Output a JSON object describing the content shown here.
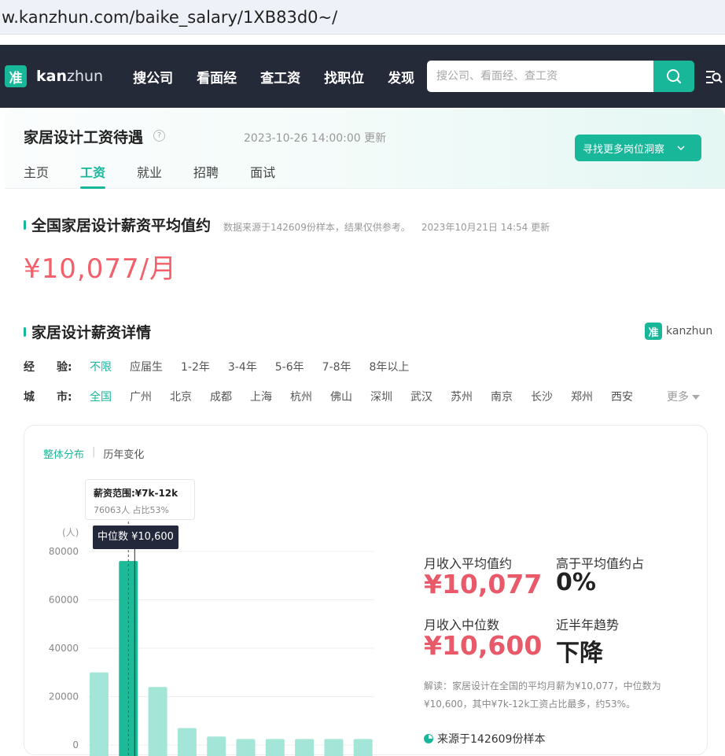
{
  "browser": {
    "url": "w.kanzhun.com/baike_salary/1XB83d0~/"
  },
  "nav": {
    "logo_mark": "准",
    "logo_bold": "kan",
    "logo_light": "zhun",
    "items": [
      "搜公司",
      "看面经",
      "查工资",
      "找职位",
      "发现"
    ],
    "search_placeholder": "搜公司、看面经、查工资"
  },
  "header": {
    "title": "家居设计工资待遇",
    "help_mark": "?",
    "update_time": "2023-10-26 14:00:00 更新",
    "insight_button": "寻找更多岗位洞察",
    "tabs": [
      "主页",
      "工资",
      "就业",
      "招聘",
      "面试"
    ]
  },
  "avg_section": {
    "title": "全国家居设计薪资平均值约",
    "note": "数据来源于142609份样本，结果仅供参考。",
    "note_time": "2023年10月21日 14:54 更新",
    "value": "¥10,077/月"
  },
  "detail_section": {
    "title": "家居设计薪资详情",
    "brand": "kanzhun",
    "experience_label": "经　　验:",
    "experience_options": [
      "不限",
      "应届生",
      "1-2年",
      "3-4年",
      "5-6年",
      "7-8年",
      "8年以上"
    ],
    "city_label": "城　　市:",
    "city_options": [
      "全国",
      "广州",
      "北京",
      "成都",
      "上海",
      "杭州",
      "佛山",
      "深圳",
      "武汉",
      "苏州",
      "南京",
      "长沙",
      "郑州",
      "西安"
    ],
    "more": "更多"
  },
  "distribution": {
    "tab_overall": "整体分布",
    "tab_history": "历年变化",
    "tooltip_title": "薪资范围:¥7k-12k",
    "tooltip_detail": "76063人  占比53%",
    "median_tag": "中位数 ¥10,600",
    "stat_avg_label": "月收入平均值约",
    "stat_avg_value": "¥10,077",
    "stat_above_label": "高于平均值约占",
    "stat_above_value": "0%",
    "stat_median_label": "月收入中位数",
    "stat_median_value": "¥10,600",
    "stat_trend_label": "近半年趋势",
    "stat_trend_value": "下降",
    "explain": "解读：家居设计在全国的平均月薪为¥10,077，中位数为¥10,600，其中¥7k-12k工资占比最多，约53%。",
    "source": "来源于142609份样本"
  },
  "chart_data": {
    "type": "bar",
    "ylabel": "(人)",
    "ylim": [
      0,
      80000
    ],
    "yticks": [
      "80000",
      "60000",
      "40000",
      "20000",
      "0"
    ],
    "values": [
      30000,
      76063,
      24000,
      7000,
      3500,
      2500,
      2500,
      2500,
      2500,
      2500
    ],
    "highlight_index": 1,
    "colors": {
      "bar": "#a3e6d8",
      "highlight": "#1dba98"
    }
  }
}
